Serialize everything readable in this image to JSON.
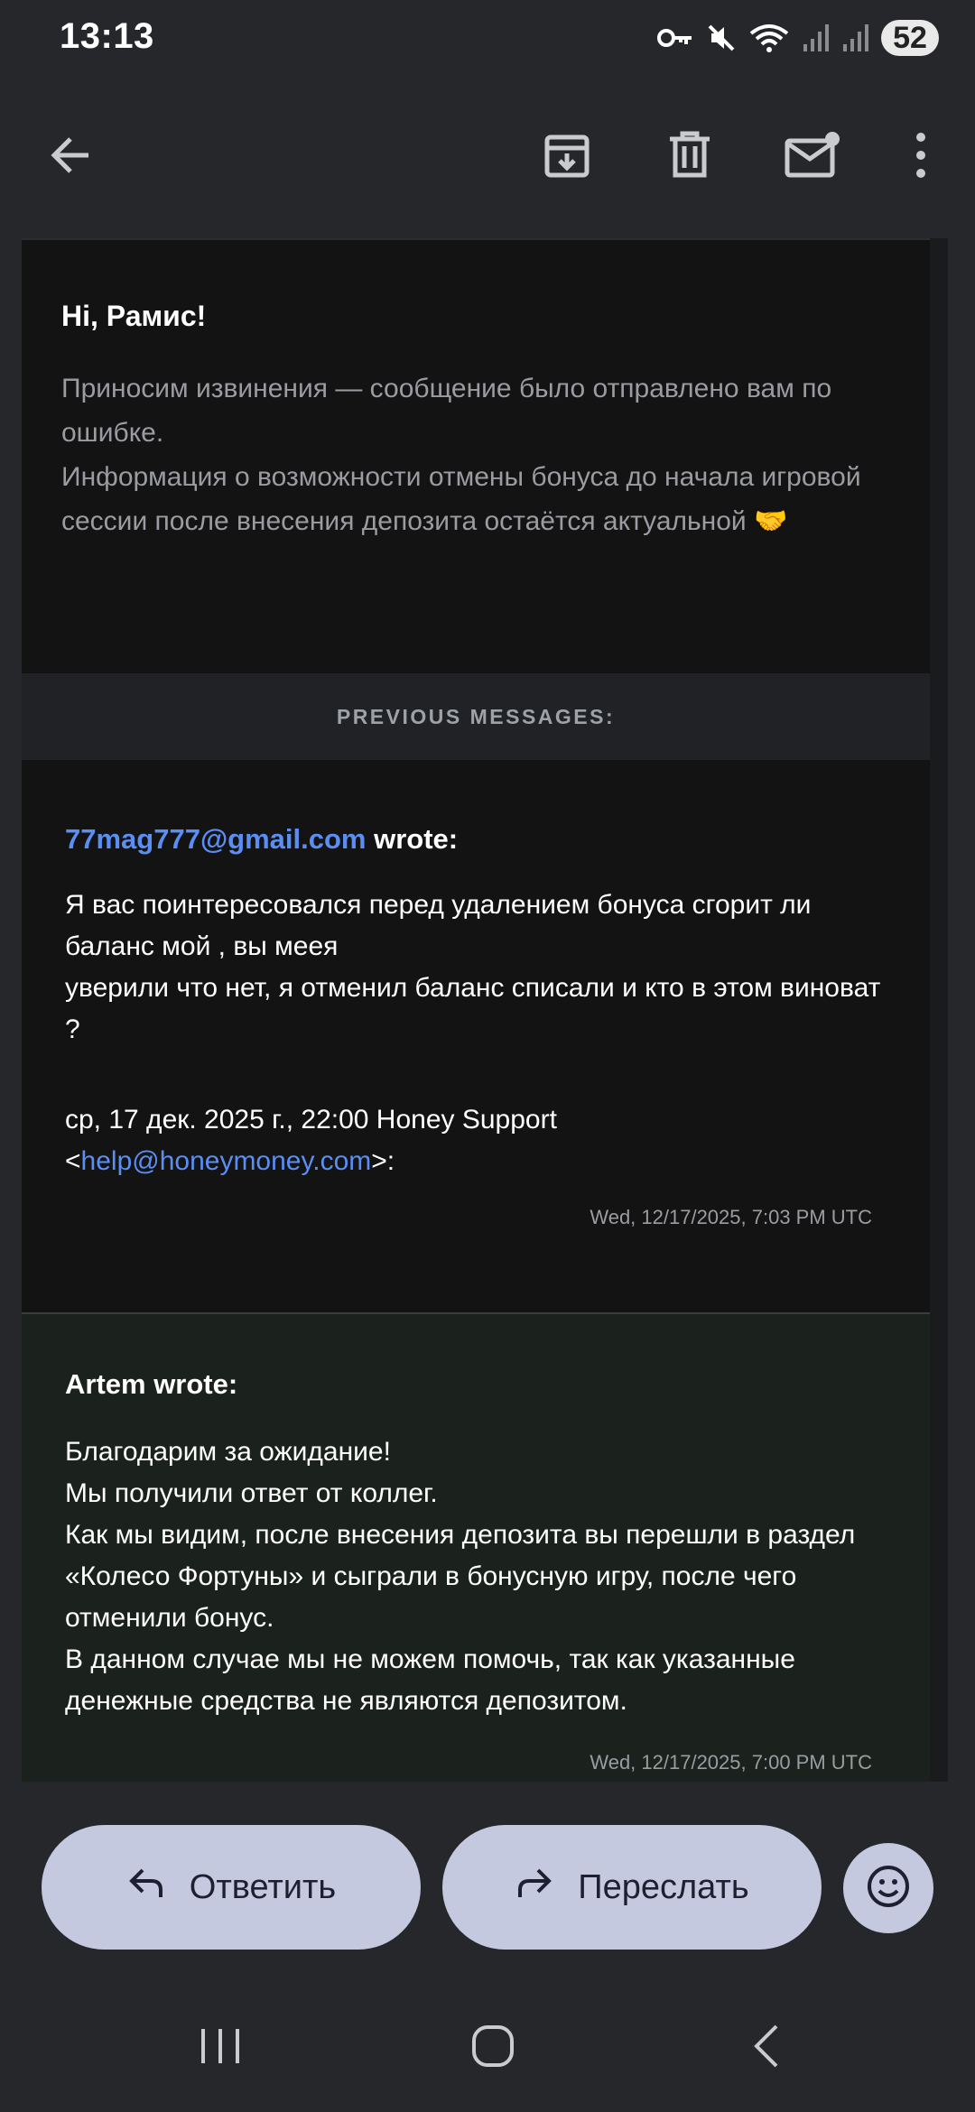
{
  "status_bar": {
    "time": "13:13",
    "battery": "52",
    "icons": [
      "key-icon",
      "mute-icon",
      "wifi-icon",
      "signal-icon",
      "signal-icon"
    ]
  },
  "toolbar": {
    "icons": [
      "back-arrow-icon",
      "archive-icon",
      "delete-icon",
      "mark-unread-icon",
      "more-vert-icon"
    ]
  },
  "email": {
    "greeting": "Hi, Рамис!",
    "apology_line1": "Приносим извинения — сообщение было отправлено вам по ошибке.",
    "apology_line2": "Информация о возможности отмены бонуса до начала игровой сессии после внесения депозита остаётся актуальной 🤝",
    "previous_label": "PREVIOUS MESSAGES:",
    "messages": [
      {
        "sender_email": "77mag777@gmail.com",
        "wrote": " wrote:",
        "body_line1": "Я вас поинтересовался перед удалением бонуса сгорит ли баланс мой , вы меея",
        "body_line2": "уверили что нет, я отменил баланс списали и кто в этом виноват ?",
        "sig_line1": "ср, 17 дек. 2025 г., 22:00 Honey Support",
        "sig_lt": "<",
        "sig_email": "help@honeymoney.com",
        "sig_gt": ">:",
        "timestamp": "Wed, 12/17/2025, 7:03 PM UTC"
      },
      {
        "header": "Artem wrote:",
        "body": [
          "Благодарим за ожидание!",
          "Мы получили ответ от коллег.",
          "Как мы видим, после внесения депозита вы перешли в раздел «Колесо Фортуны» и сыграли в бонусную игру, после чего отменили бонус.",
          "В данном случае мы не можем помочь, так как указанные денежные средства не являются депозитом."
        ],
        "timestamp": "Wed, 12/17/2025, 7:00 PM UTC"
      }
    ]
  },
  "actions": {
    "reply_label": "Ответить",
    "forward_label": "Переслать"
  },
  "colors": {
    "link": "#5b8ef2",
    "pill": "#c4c9e0",
    "background": "#131314"
  }
}
